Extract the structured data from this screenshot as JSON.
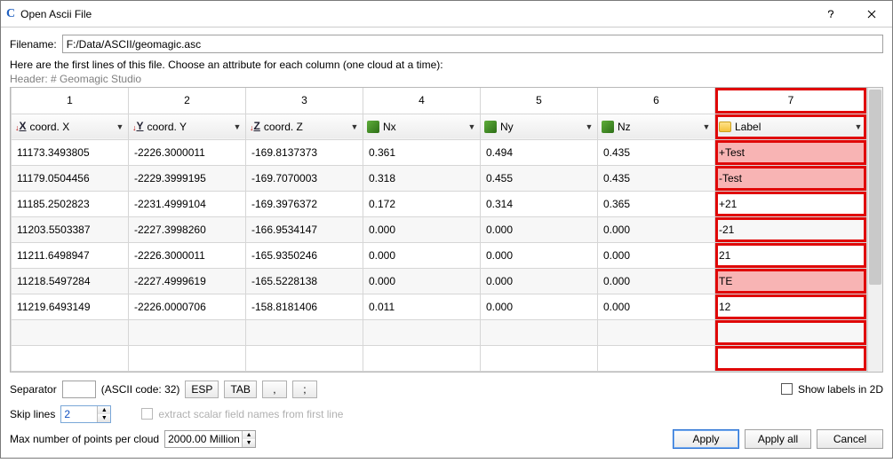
{
  "window": {
    "title": "Open Ascii File"
  },
  "filename_label": "Filename:",
  "filename_value": "F:/Data/ASCII/geomagic.asc",
  "instruction": "Here are the first lines of this file. Choose an attribute for each column (one cloud at a time):",
  "header_line": "Header: # Geomagic Studio",
  "col_nums": [
    "1",
    "2",
    "3",
    "4",
    "5",
    "6",
    "7"
  ],
  "col_attrs": [
    {
      "icon": "xyz",
      "label": "coord. X"
    },
    {
      "icon": "xyz",
      "label": "coord. Y"
    },
    {
      "icon": "xyz",
      "label": "coord. Z"
    },
    {
      "icon": "norm",
      "label": "Nx"
    },
    {
      "icon": "norm",
      "label": "Ny"
    },
    {
      "icon": "norm",
      "label": "Nz"
    },
    {
      "icon": "tag",
      "label": "Label"
    }
  ],
  "rows": [
    {
      "c": [
        "11173.3493805",
        "-2226.3000011",
        "-169.8137373",
        "0.361",
        "0.494",
        "0.435",
        "+Test"
      ],
      "pink": true
    },
    {
      "c": [
        "11179.0504456",
        "-2229.3999195",
        "-169.7070003",
        "0.318",
        "0.455",
        "0.435",
        "-Test"
      ],
      "pink": true
    },
    {
      "c": [
        "11185.2502823",
        "-2231.4999104",
        "-169.3976372",
        "0.172",
        "0.314",
        "0.365",
        "+21"
      ],
      "pink": false
    },
    {
      "c": [
        "11203.5503387",
        "-2227.3998260",
        "-166.9534147",
        "0.000",
        "0.000",
        "0.000",
        "-21"
      ],
      "pink": false
    },
    {
      "c": [
        "11211.6498947",
        "-2226.3000011",
        "-165.9350246",
        "0.000",
        "0.000",
        "0.000",
        "21"
      ],
      "pink": false
    },
    {
      "c": [
        "11218.5497284",
        "-2227.4999619",
        "-165.5228138",
        "0.000",
        "0.000",
        "0.000",
        "TE"
      ],
      "pink": true
    },
    {
      "c": [
        "11219.6493149",
        "-2226.0000706",
        "-158.8181406",
        "0.011",
        "0.000",
        "0.000",
        "12"
      ],
      "pink": false
    },
    {
      "c": [
        "",
        "",
        "",
        "",
        "",
        "",
        ""
      ],
      "pink": false
    },
    {
      "c": [
        "",
        "",
        "",
        "",
        "",
        "",
        ""
      ],
      "pink": false
    }
  ],
  "separator_label": "Separator",
  "separator_value": "",
  "ascii_code_label": "(ASCII code: 32)",
  "btn_esp": "ESP",
  "btn_tab": "TAB",
  "btn_comma": ",",
  "btn_semicolon": ";",
  "show_labels_label": "Show labels in 2D",
  "skip_label": "Skip lines",
  "skip_value": "2",
  "extract_label": "extract scalar field names from first line",
  "max_label": "Max number of points per cloud",
  "max_value": "2000.00 Million",
  "btn_apply": "Apply",
  "btn_applyall": "Apply all",
  "btn_cancel": "Cancel"
}
